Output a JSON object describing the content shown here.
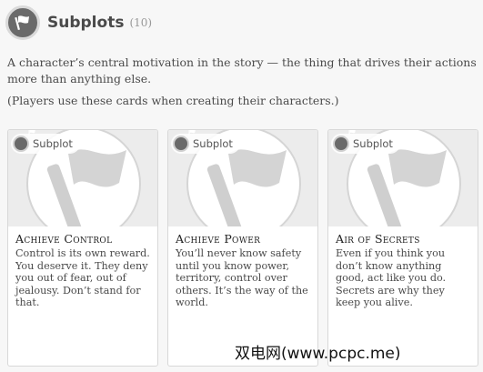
{
  "header": {
    "icon": "flag-icon",
    "title": "Subplots",
    "count": "(10)"
  },
  "description": "A character’s central motivation in the story — the thing that drives their actions more than anything else.",
  "note": "(Players use these cards when creating their characters.)",
  "cards": [
    {
      "tag": "Subplot",
      "icon": "flag-icon",
      "title": "Achieve Control",
      "text": "Control is its own reward. You deserve it. They deny you out of fear, out of jealousy. Don’t stand for that."
    },
    {
      "tag": "Subplot",
      "icon": "flag-icon",
      "title": "Achieve Power",
      "text": "You’ll never know safety until you know power, territory, control over others. It’s the way of the world."
    },
    {
      "tag": "Subplot",
      "icon": "flag-icon",
      "title": "Air of Secrets",
      "text": "Even if you think you don’t know anything good, act like you do. Secrets are why they keep you alive."
    }
  ],
  "watermark": "双电网(www.pcpc.me)",
  "colors": {
    "icon_bg": "#6a6a6a",
    "card_art_bg": "#ececec",
    "page_bg": "#f7f7f7"
  }
}
